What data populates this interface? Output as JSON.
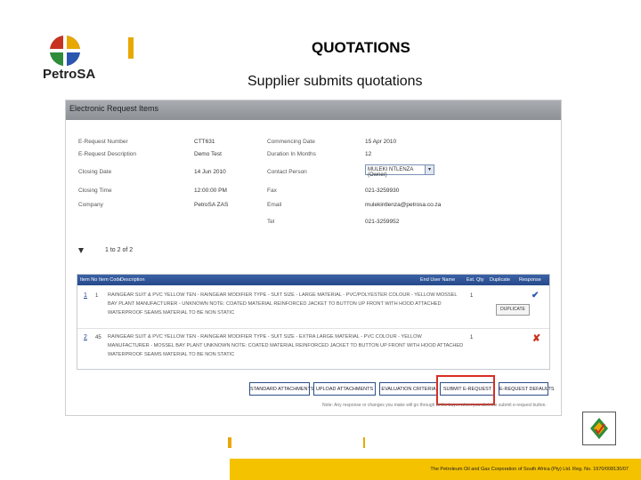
{
  "brand": {
    "name": "PetroSA"
  },
  "slide": {
    "title": "QUOTATIONS",
    "subtitle": "Supplier submits quotations"
  },
  "panel": {
    "title": "Electronic Request Items",
    "fields_left": [
      {
        "label": "E-Request Number",
        "value": "CTT631"
      },
      {
        "label": "E-Request Description",
        "value": "Demo Test"
      },
      {
        "label": "Closing Date",
        "value": "14 Jun 2010"
      },
      {
        "label": "Closing Time",
        "value": "12:00:00 PM"
      },
      {
        "label": "Company",
        "value": "PetroSA ZAS"
      }
    ],
    "fields_right": [
      {
        "label": "Commencing Date",
        "value": "15 Apr 2010"
      },
      {
        "label": "Duration In Months",
        "value": "12"
      },
      {
        "label": "Contact Person",
        "value": "MULEKI NTLENZA (Owner)"
      },
      {
        "label": "Fax",
        "value": "021-3259930"
      },
      {
        "label": "Email",
        "value": "mulekintlenza@petrosa.co.za"
      },
      {
        "label": "Tel",
        "value": "021-3259952"
      }
    ],
    "page_info": "1 to 2 of 2",
    "grid": {
      "columns": [
        "Item No",
        "Item Code",
        "Description",
        "End User Name",
        "Est. Qty",
        "Duplicate",
        "Response"
      ],
      "rows": [
        {
          "num": "1",
          "item": "1",
          "qty": "1",
          "description": "RAINGEAR SUIT & PVC YELLOW TEN - RAINGEAR MODIFIER TYPE - SUIT SIZE - LARGE MATERIAL - PVC/POLYESTER COLOUR - YELLOW MOSSEL BAY PLANT MANUFACTURER - UNKNOWN NOTE: COATED MATERIAL REINFORCED JACKET TO BUTTON UP FRONT WITH HOOD ATTACHED WATERPROOF SEAMS MATERIAL TO BE NON STATIC",
          "duplicate": "DUPLICATE",
          "response": "ok"
        },
        {
          "num": "2",
          "item": "45",
          "qty": "1",
          "description": "RAINGEAR SUIT & PVC YELLOW TEN - RAINGEAR MODIFIER TYPE - SUIT SIZE - EXTRA LARGE MATERIAL - PVC COLOUR - YELLOW MANUFACTURER - MOSSEL BAY PLANT UNKNOWN NOTE: COATED MATERIAL REINFORCED JACKET TO BUTTON UP FRONT WITH HOOD ATTACHED WATERPROOF SEAMS MATERIAL TO BE NON STATIC",
          "duplicate": "",
          "response": "no"
        }
      ]
    },
    "buttons": [
      "STANDARD ATTACHMENTS",
      "UPLOAD ATTACHMENTS",
      "EVALUATION CRITERIA",
      "SUBMIT E-REQUEST",
      "E-REQUEST DEFAULTS"
    ],
    "note": "Note: Any response or changes you make will go through to the buyer when you click the submit e-request button."
  },
  "footer": {
    "text": "The Petroleum Oil and Gas Corporation of South Africa (Pty) Ltd. Reg. No. 1970/008130/07"
  },
  "colors": {
    "accent": "#f5c200",
    "grid_header": "#26498a",
    "highlight": "#d92d24"
  }
}
